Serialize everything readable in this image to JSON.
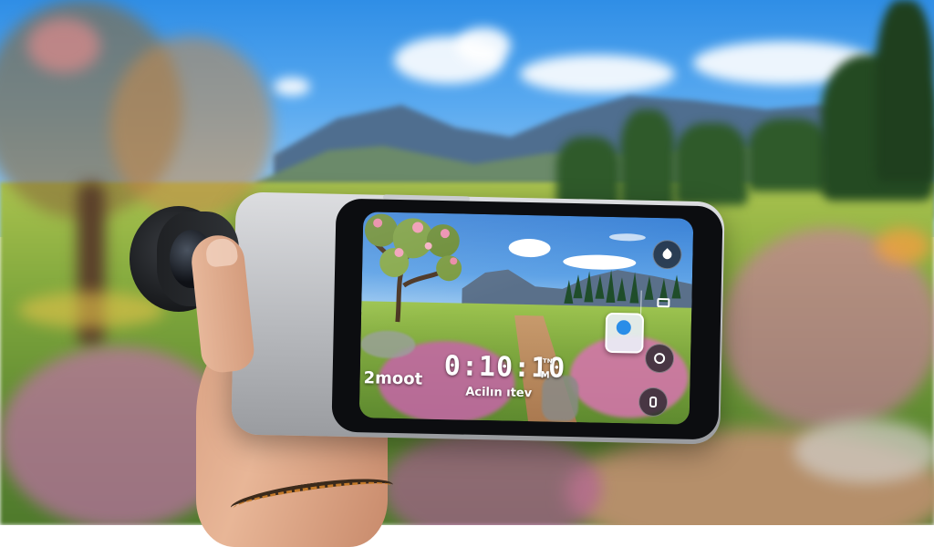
{
  "viewfinder": {
    "timer": "0:10:10",
    "timer_suffix_top": "ᵀᴺ",
    "timer_suffix_bottom": "M",
    "mode_label": "2moot",
    "sub_label": "Acilın ıtev"
  },
  "controls": {
    "top_button_icon": "drop-icon",
    "settings_icon": "grid-icon",
    "focus_icon": "focus-dot-icon",
    "effects_icon": "face-icon",
    "capture_icon": "camera-icon"
  },
  "colors": {
    "focus_accent": "#2a8de8",
    "phone_body": "#b7b9bd",
    "screen_bezel": "#0c0d10"
  }
}
